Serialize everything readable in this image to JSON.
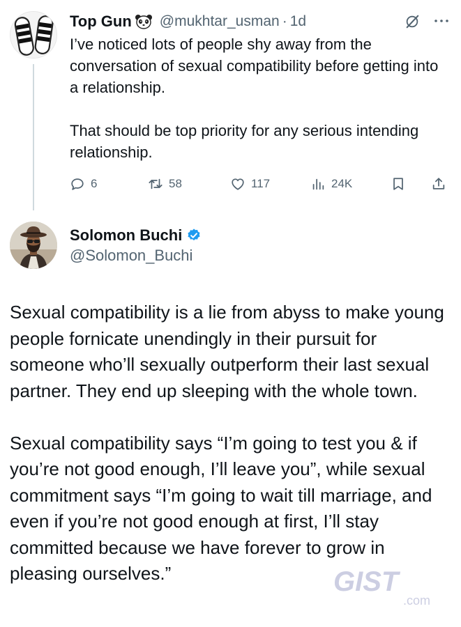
{
  "parent_tweet": {
    "display_name": "Top Gun",
    "handle": "@mukhtar_usman",
    "separator": "·",
    "time": "1d",
    "paragraphs": [
      "I’ve noticed lots of people shy away from the conversation of sexual compatibility before getting into a relationship.",
      "That should be top priority for any serious intending relationship."
    ],
    "stats": {
      "replies": "6",
      "reposts": "58",
      "likes": "117",
      "views": "24K"
    }
  },
  "main_tweet": {
    "display_name": "Solomon Buchi",
    "handle": "@Solomon_Buchi",
    "verified_color": "#1d9bf0",
    "paragraphs": [
      "Sexual compatibility is a lie from abyss to make young people fornicate unendingly in their pursuit for someone who’ll sexually outperform their last sexual partner. They end up sleeping with the whole town.",
      "Sexual compatibility says “I’m going to test you & if you’re not good enough, I’ll leave you”, while sexual commitment says “I’m going to wait till marriage, and even if you’re not good enough at first, I’ll stay committed because we have forever to grow in pleasing ourselves.”"
    ]
  },
  "icons": {
    "reply": "reply-icon",
    "repost": "repost-icon",
    "like": "heart-icon",
    "views": "views-icon",
    "bookmark": "bookmark-icon",
    "share": "share-icon",
    "grok": "grok-icon",
    "more": "more-icon",
    "verified": "verified-badge-icon",
    "panda": "panda-emoji-icon"
  },
  "colors": {
    "text": "#0f1419",
    "secondary": "#536471",
    "thread_line": "#cfd9de",
    "verified": "#1d9bf0"
  },
  "watermark": {
    "brand": "GIST",
    "suffix": ".com"
  }
}
